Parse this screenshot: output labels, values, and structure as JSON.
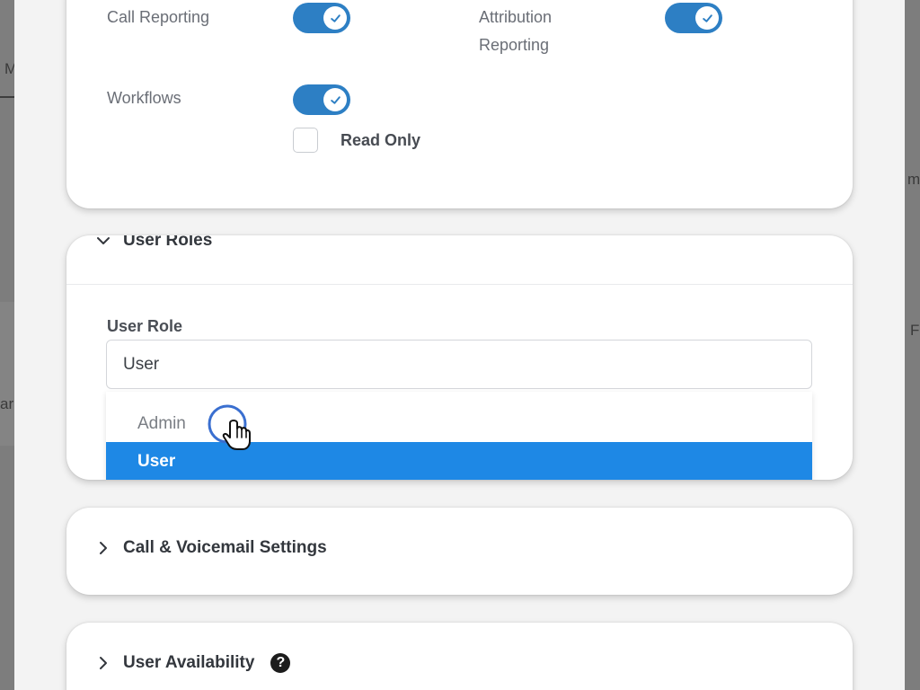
{
  "background": {
    "left_fragments": [
      "M",
      "ar"
    ],
    "right_fragments": [
      "m",
      "F"
    ]
  },
  "permissions": {
    "items": [
      {
        "label": "Call Reporting",
        "enabled": true
      },
      {
        "label_line1": "Attribution",
        "label_line2": "Reporting",
        "enabled": true
      },
      {
        "label": "Workflows",
        "enabled": true
      }
    ],
    "read_only_label": "Read Only",
    "read_only_checked": false
  },
  "user_roles": {
    "section_title": "User Roles",
    "field_label": "User Role",
    "selected_value": "User",
    "options": [
      "Admin",
      "User"
    ],
    "highlighted_option": "User"
  },
  "sections": {
    "call_voicemail": "Call & Voicemail Settings",
    "user_availability": "User Availability"
  },
  "colors": {
    "toggle_on": "#2d7fc4",
    "highlight": "#1e88e5"
  }
}
